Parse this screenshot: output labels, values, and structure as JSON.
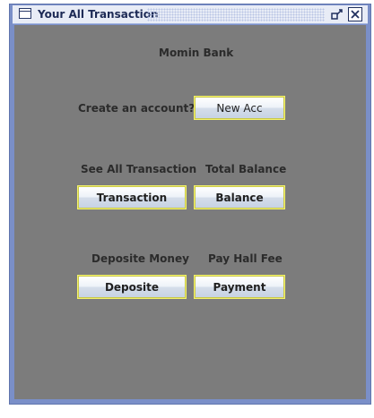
{
  "window": {
    "title": "Your All Transaction"
  },
  "content": {
    "bank_name": "Momin Bank",
    "create_account_label": "Create an account?",
    "new_account_button": "New Acc",
    "see_transactions_label": "See All Transaction",
    "total_balance_label": "Total Balance",
    "transaction_button": "Transaction",
    "balance_button": "Balance",
    "deposit_label": "Deposite Money",
    "pay_hall_fee_label": "Pay Hall Fee",
    "deposit_button": "Deposite",
    "payment_button": "Payment"
  }
}
